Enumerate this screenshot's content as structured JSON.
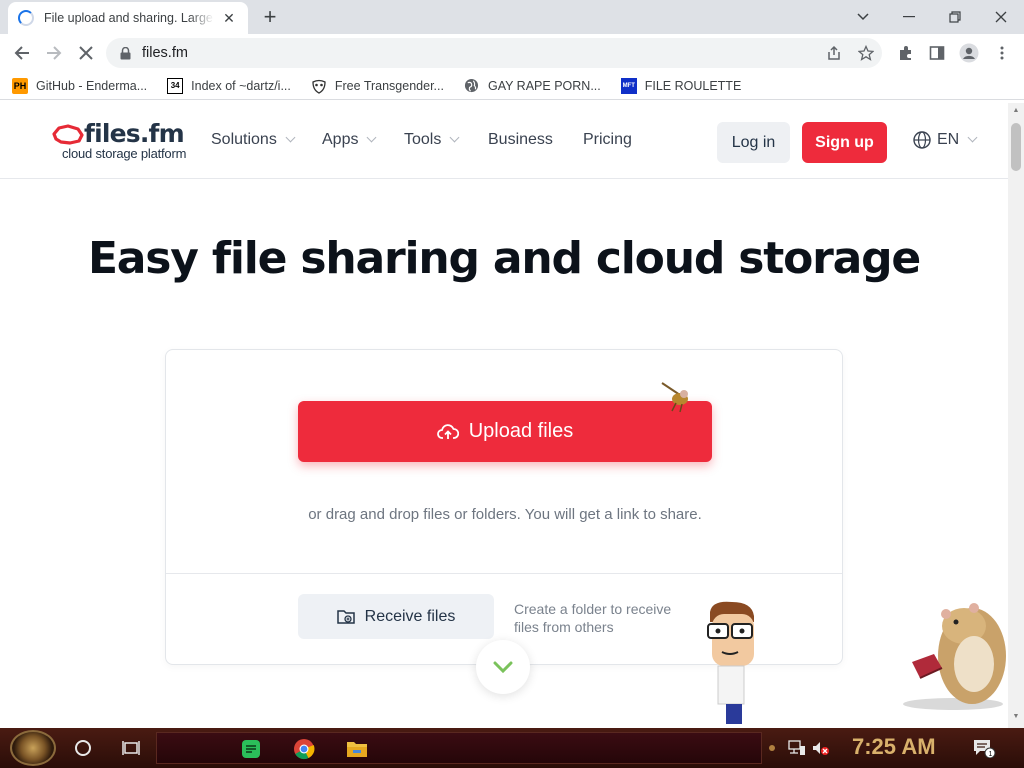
{
  "browser": {
    "tab_title": "File upload and sharing. Large files",
    "tab_close": "✕",
    "new_tab": "+",
    "url": "files.fm",
    "bookmarks": [
      {
        "label": "GitHub - Enderma...",
        "icon": "PH"
      },
      {
        "label": "Index of ~dartz/i...",
        "icon": "34"
      },
      {
        "label": "Free Transgender...",
        "icon": "mask-icon"
      },
      {
        "label": "GAY RAPE PORN...",
        "icon": "globe-icon"
      },
      {
        "label": "FILE ROULETTE",
        "icon": "MFT"
      }
    ]
  },
  "site": {
    "logo_text": "files.fm",
    "logo_tagline": "cloud storage platform",
    "nav": [
      {
        "label": "Solutions",
        "dropdown": true
      },
      {
        "label": "Apps",
        "dropdown": true
      },
      {
        "label": "Tools",
        "dropdown": true
      },
      {
        "label": "Business",
        "dropdown": false
      },
      {
        "label": "Pricing",
        "dropdown": false
      }
    ],
    "login": "Log in",
    "signup": "Sign up",
    "language": "EN",
    "accent_color": "#ee2b3c"
  },
  "hero": {
    "title": "Easy file sharing and cloud storage",
    "upload_button": "Upload files",
    "drop_text": "or drag and drop files or folders. You will get a link to share.",
    "receive_button": "Receive files",
    "receive_desc": "Create a folder to receive files from others"
  },
  "taskbar": {
    "time": "7:25 AM",
    "notifications": "1"
  }
}
